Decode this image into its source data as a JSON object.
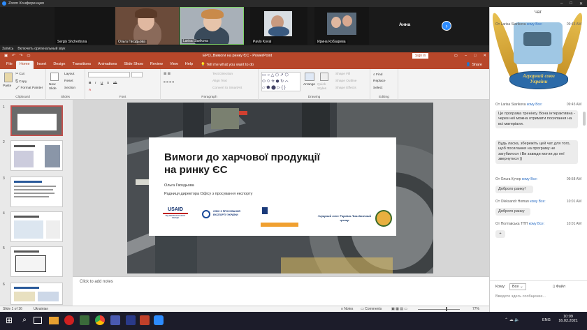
{
  "zoom": {
    "title": "Zoom Конференция",
    "participants": [
      {
        "name": "Sergiy Shcherbyna"
      },
      {
        "name": "Ольга Гвоздьова"
      },
      {
        "name": "Larisa Starikova"
      },
      {
        "name": "Pavlo Koval"
      },
      {
        "name": "Ирина Кобзарева"
      },
      {
        "name": "Анна"
      }
    ],
    "meeting_bar": {
      "item1": "Запись",
      "item2": "Включить оригинальный звук"
    }
  },
  "powerpoint": {
    "window_title": "EPO_Вимоги на ринку ЄС  -  PowerPoint",
    "sign_in": "Sign in",
    "tabs": [
      "File",
      "Home",
      "Insert",
      "Design",
      "Transitions",
      "Animations",
      "Slide Show",
      "Review",
      "View",
      "Help"
    ],
    "active_tab": "Home",
    "tell_me": "Tell me what you want to do",
    "share": "Share",
    "ribbon": {
      "clipboard": {
        "label": "Clipboard",
        "paste": "Paste",
        "cut": "Cut",
        "copy": "Copy",
        "format_painter": "Format Painter"
      },
      "slides": {
        "label": "Slides",
        "new_slide": "New Slide",
        "layout": "Layout",
        "reset": "Reset",
        "section": "Section"
      },
      "font": {
        "label": "Font"
      },
      "paragraph": {
        "label": "Paragraph",
        "text_direction": "Text Direction",
        "align_text": "Align Text",
        "convert": "Convert to SmartArt"
      },
      "drawing": {
        "label": "Drawing",
        "arrange": "Arrange",
        "quick_styles": "Quick Styles",
        "shape_fill": "Shape Fill",
        "shape_outline": "Shape Outline",
        "shape_effects": "Shape Effects"
      },
      "editing": {
        "label": "Editing",
        "find": "Find",
        "replace": "Replace",
        "select": "Select"
      }
    },
    "slide": {
      "title_line1": "Вимоги до харчової продукції",
      "title_line2": "на ринку ЄС",
      "author": "Ольга Гвоздьова",
      "role": "Радниця директора Офісу з просування експорту",
      "logo_usaid": "USAID",
      "logo_usaid_sub": "ВІД АМЕРИКАНСЬКОГО НАРОДУ",
      "logo_epo": "ОФІС З ПРОСУВАННЯ ЕКСПОРТУ УКРАЇНИ",
      "logo_agro": "Аграрний союз України Аналітичний центр"
    },
    "notes_placeholder": "Click to add notes",
    "status": {
      "slide_of": "Slide 1 of 16",
      "language": "Ukrainian",
      "notes": "Notes",
      "comments": "Comments",
      "zoom": "77%"
    },
    "thumbnail_numbers": [
      "1",
      "2",
      "3",
      "4",
      "5",
      "6"
    ]
  },
  "chat": {
    "header": "Чат",
    "badge_text": "Аграрний союз України",
    "messages": [
      {
        "from": "От Larisa Starikova",
        "to": "кому Все:",
        "time": "09:43 AM",
        "text": ""
      },
      {
        "from": "От Larisa Starikova",
        "to": "кому Все:",
        "time": "09:45 AM",
        "text": "Це програма тренінгу. Вона інтерактивна - через неї можна отримати посилання на всі матеріали."
      },
      {
        "from": "",
        "to": "",
        "time": "",
        "text": "Будь ласка, збережіть цей чат для того, щоб посилання на програму не загубилося і Ви завжди могли до неї звернутися ))"
      },
      {
        "from": "От Ольга Кучер",
        "to": "кому Все:",
        "time": "09:58 AM",
        "text": "Доброго ранку!"
      },
      {
        "from": "От Oleksandr Homan",
        "to": "кому Все:",
        "time": "10:01 AM",
        "text": "Доброго ранку"
      },
      {
        "from": "От Полтавська ТПП",
        "to": "кому Все:",
        "time": "10:01 AM",
        "text": "+"
      }
    ],
    "to_label": "Кому:",
    "to_value": "Все",
    "file_label": "Файл",
    "input_placeholder": "Введите здесь сообщение..."
  },
  "taskbar": {
    "language": "ENG",
    "time": "10:09",
    "date": "16.02.2021"
  },
  "colors": {
    "ppt_accent": "#b7472a",
    "zoom_blue": "#2d8cff",
    "taskbar": "#1c1c2a"
  }
}
